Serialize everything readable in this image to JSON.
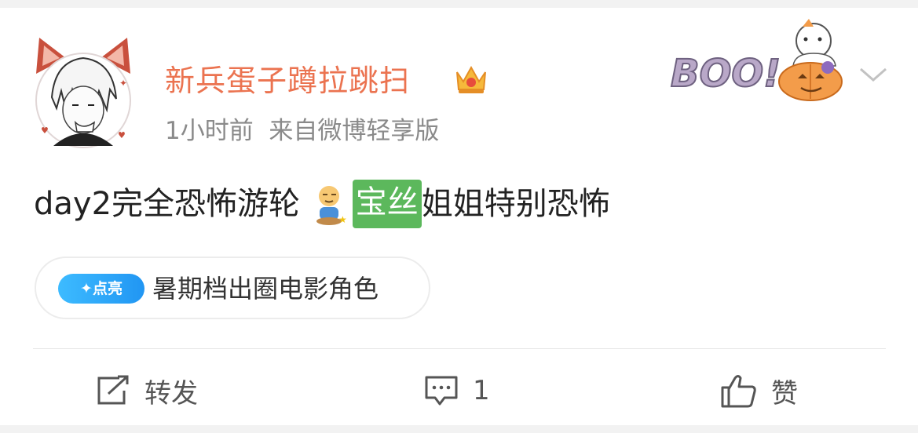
{
  "post": {
    "username": "新兵蛋子蹲拉跳扫",
    "meta": "1小时前  来自微博轻享版",
    "content_before": "day2完全恐怖游轮 ",
    "content_highlight": "宝丝",
    "content_after": "姐姐特别恐怖",
    "decoration_text": "BOO!"
  },
  "topic": {
    "badge": "✦点亮",
    "text": "暑期档出圈电影角色"
  },
  "actions": {
    "repost": "转发",
    "comment_count": "1",
    "like": "赞"
  },
  "colors": {
    "username": "#eb7350",
    "highlight": "#5cb85c",
    "badge": "#2196f3"
  }
}
